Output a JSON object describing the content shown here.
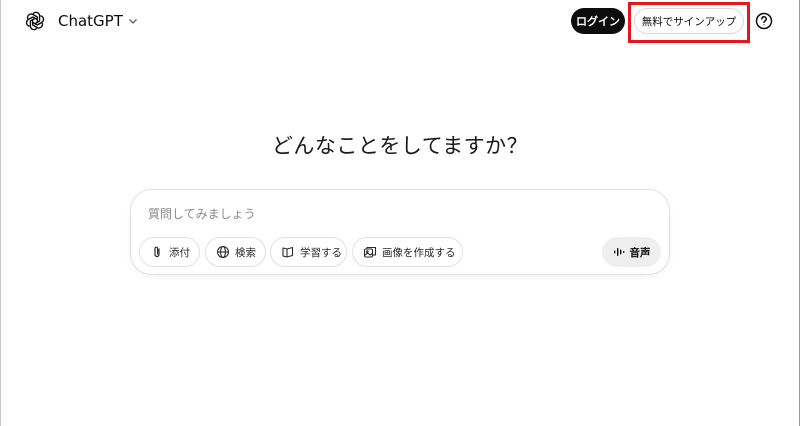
{
  "header": {
    "logo_icon": "openai-logo-icon",
    "model_name": "ChatGPT",
    "model_dropdown_icon": "chevron-down-icon",
    "login_label": "ログイン",
    "signup_label": "無料でサインアップ",
    "help_icon": "question-circle-icon",
    "highlight_color": "#e6161e"
  },
  "main": {
    "headline": "どんなことをしてますか？"
  },
  "composer": {
    "placeholder": "質問してみましょう",
    "value": "",
    "tools": [
      {
        "label": "添付",
        "icon": "paperclip-icon"
      },
      {
        "label": "検索",
        "icon": "globe-icon"
      },
      {
        "label": "学習する",
        "icon": "book-icon"
      },
      {
        "label": "画像を作成する",
        "icon": "image-create-icon"
      }
    ],
    "voice_label": "音声",
    "voice_icon": "voice-waveform-icon"
  }
}
